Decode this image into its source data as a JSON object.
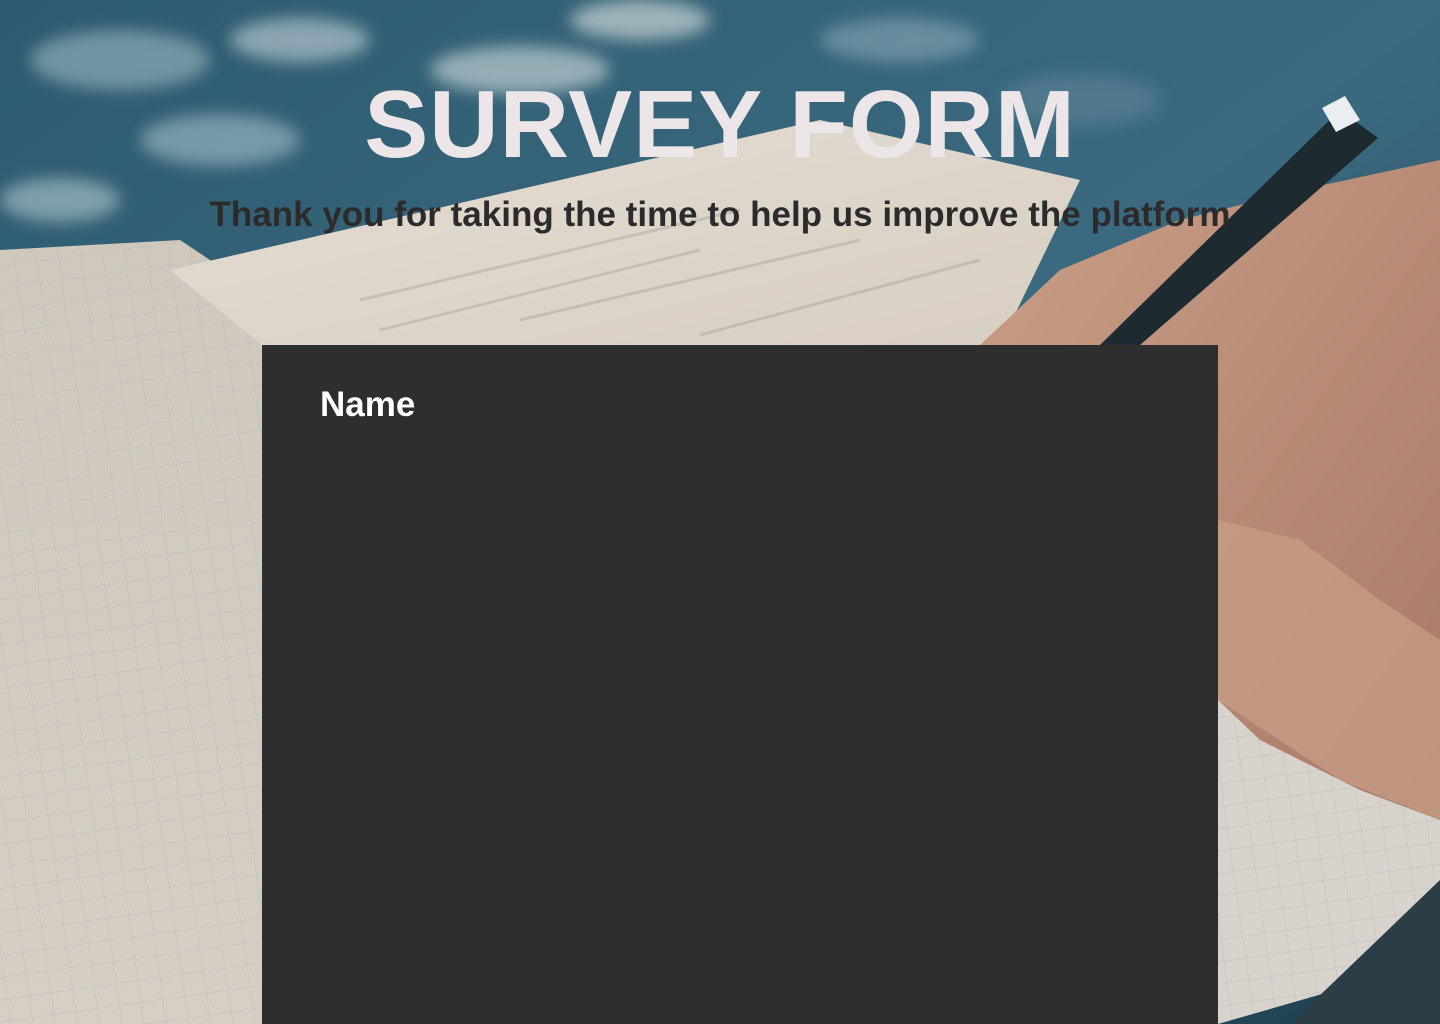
{
  "header": {
    "title": "SURVEY FORM",
    "subtitle": "Thank you for taking the time to help us improve the platform"
  },
  "form": {
    "fields": [
      {
        "label": "Name"
      }
    ]
  },
  "colors": {
    "title": "#ece6e8",
    "subtitle": "#2c2a2a",
    "form_background": "#2e2e2e",
    "label": "#ffffff"
  }
}
